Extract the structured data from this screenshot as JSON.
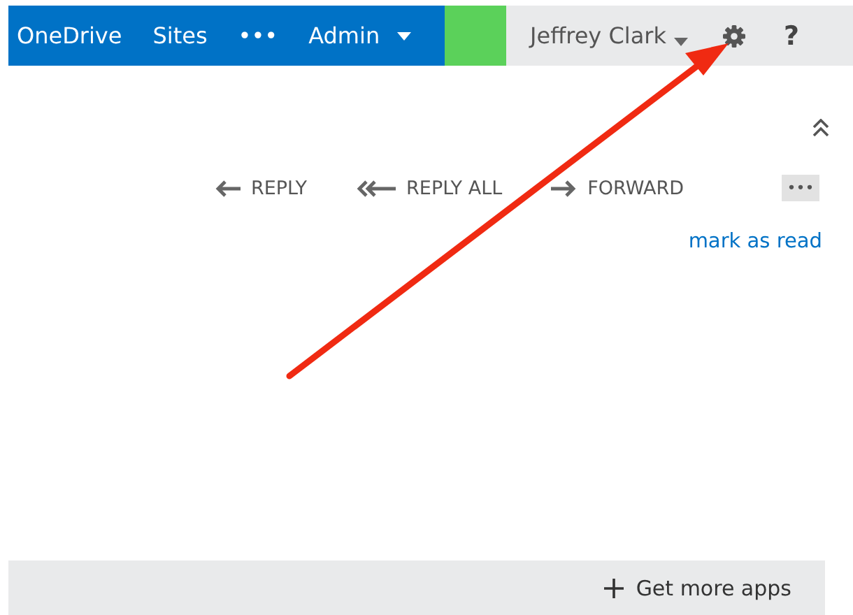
{
  "top_bar": {
    "nav": [
      {
        "kind": "link",
        "label": "OneDrive"
      },
      {
        "kind": "link",
        "label": "Sites"
      },
      {
        "kind": "link",
        "label": "•••"
      },
      {
        "kind": "menu",
        "label": "Admin"
      }
    ],
    "user": {
      "name": "Jeffrey Clark"
    },
    "help": "?"
  },
  "message_actions": [
    {
      "kind": "reply",
      "label": "REPLY"
    },
    {
      "kind": "reply_all",
      "label": "REPLY ALL"
    },
    {
      "kind": "forward",
      "label": "FORWARD"
    },
    {
      "kind": "more",
      "label": "•••"
    }
  ],
  "mark_as_read": "mark as read",
  "footer": {
    "label": "Get more apps"
  },
  "annotation": {
    "kind": "arrow"
  }
}
